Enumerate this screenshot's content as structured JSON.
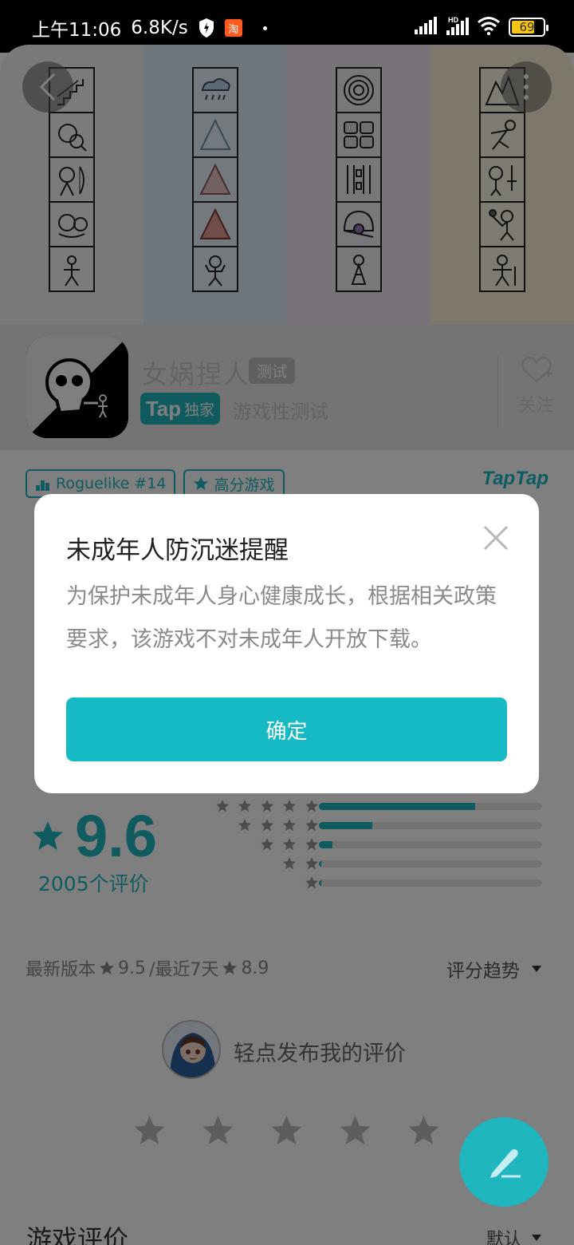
{
  "status_bar": {
    "time": "上午11:06",
    "speed": "6.8K/s",
    "battery": "69"
  },
  "app": {
    "name": "女娲捏人",
    "test_tag": "测试",
    "tap_label": "Tap",
    "exclusive_label": "独家",
    "subtitle": "游戏性测试",
    "follow_label": "关注"
  },
  "tags": [
    {
      "label": "Roguelike #14",
      "icon": "ranking-icon"
    },
    {
      "label": "高分游戏",
      "icon": "star-badge-icon"
    }
  ],
  "brand": "TapTap",
  "rating": {
    "score": "9.6",
    "count_label": "2005个评价",
    "distribution": [
      {
        "stars": 5,
        "fraction": 0.7
      },
      {
        "stars": 4,
        "fraction": 0.24
      },
      {
        "stars": 3,
        "fraction": 0.06
      },
      {
        "stars": 2,
        "fraction": 0.01
      },
      {
        "stars": 1,
        "fraction": 0.01
      }
    ],
    "version_label": "最新版本",
    "version_score": "9.5",
    "recent_label": "/最近7天",
    "recent_score": "8.9",
    "trend_label": "评分趋势"
  },
  "publish_label": "轻点发布我的评价",
  "reviews_title": "游戏评价",
  "sort_label": "默认",
  "modal": {
    "title": "未成年人防沉迷提醒",
    "body": "为保护未成年人身心健康成长，根据相关政策要求，该游戏不对未成年人开放下载。",
    "confirm_label": "确定"
  },
  "colors": {
    "accent": "#15bac5",
    "overlay": "rgba(0,0,0,0.5)"
  }
}
